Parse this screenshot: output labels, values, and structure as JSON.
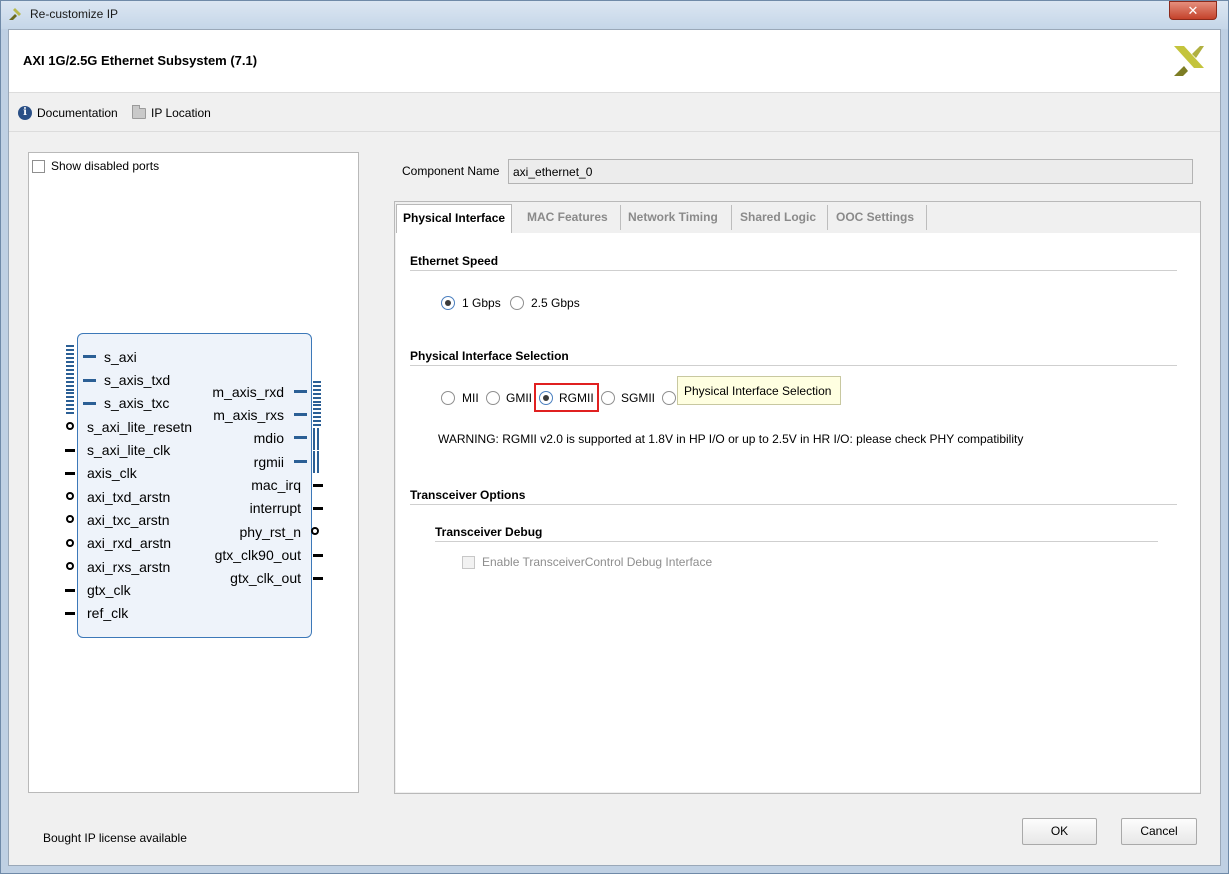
{
  "window": {
    "title": "Re-customize IP",
    "close_glyph": "✕",
    "app_icon": "xilinx-logo-icon"
  },
  "header": {
    "ip_title": "AXI 1G/2.5G Ethernet Subsystem (7.1)",
    "logo_icon": "xilinx-logo-icon"
  },
  "toolbar": {
    "documentation_label": "Documentation",
    "documentation_icon": "info-icon",
    "ip_location_label": "IP Location",
    "ip_location_icon": "folder-icon"
  },
  "symbol_panel": {
    "show_disabled_label": "Show disabled ports",
    "show_disabled_checked": false,
    "left_ports": [
      "s_axi",
      "s_axis_txd",
      "s_axis_txc",
      "s_axi_lite_resetn",
      "s_axi_lite_clk",
      "axis_clk",
      "axi_txd_arstn",
      "axi_txc_arstn",
      "axi_rxd_arstn",
      "axi_rxs_arstn",
      "gtx_clk",
      "ref_clk"
    ],
    "right_ports": [
      "m_axis_rxd",
      "m_axis_rxs",
      "mdio",
      "rgmii",
      "mac_irq",
      "interrupt",
      "phy_rst_n",
      "gtx_clk90_out",
      "gtx_clk_out"
    ]
  },
  "component": {
    "label": "Component Name",
    "value": "axi_ethernet_0"
  },
  "tabs": [
    {
      "label": "Physical Interface",
      "active": true
    },
    {
      "label": "MAC Features",
      "active": false
    },
    {
      "label": "Network Timing",
      "active": false
    },
    {
      "label": "Shared Logic",
      "active": false
    },
    {
      "label": "OOC Settings",
      "active": false
    }
  ],
  "ethernet_speed": {
    "title": "Ethernet Speed",
    "options": [
      "1 Gbps",
      "2.5 Gbps"
    ],
    "selected": "1 Gbps"
  },
  "phy_interface": {
    "title": "Physical Interface Selection",
    "options": [
      "MII",
      "GMII",
      "RGMII",
      "SGMII"
    ],
    "selected": "RGMII",
    "tooltip": "Physical Interface Selection",
    "warning": "WARNING: RGMII v2.0 is supported at 1.8V in HP I/O or up to 2.5V in HR I/O: please check PHY compatibility"
  },
  "transceiver": {
    "title": "Transceiver Options",
    "debug_title": "Transceiver Debug",
    "debug_checkbox_label": "Enable TransceiverControl Debug Interface",
    "debug_checkbox_enabled": false
  },
  "footer": {
    "license_text": "Bought IP license available",
    "ok_label": "OK",
    "cancel_label": "Cancel"
  }
}
